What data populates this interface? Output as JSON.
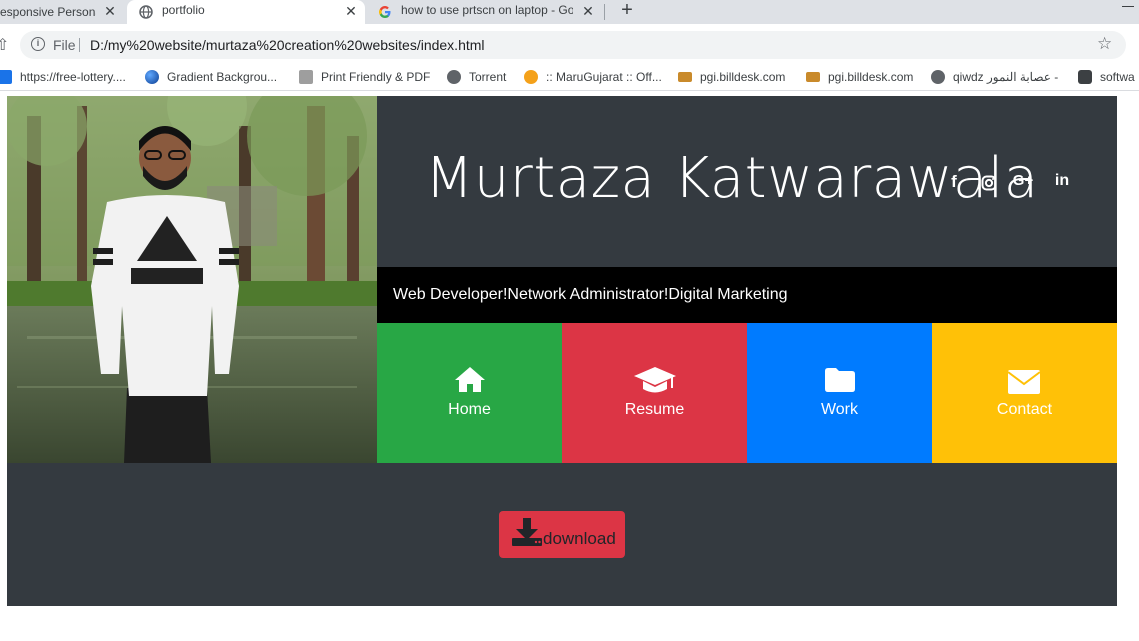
{
  "browser": {
    "tabs": [
      {
        "title": "esponsive Persona",
        "active": false
      },
      {
        "title": "portfolio",
        "active": true
      },
      {
        "title": "how to use prtscn on laptop - Go",
        "active": false
      }
    ],
    "close_glyph": "✕",
    "new_tab_glyph": "+",
    "url_scheme": "File",
    "url": "D:/my%20website/murtaza%20creation%20websites/index.html",
    "bookmarks": [
      {
        "label": "https://free-lottery....",
        "icon": "lottery-icon"
      },
      {
        "label": "Gradient Backgrou...",
        "icon": "gradient-globe-icon"
      },
      {
        "label": "Print Friendly & PDF",
        "icon": "printer-icon"
      },
      {
        "label": "Torrent",
        "icon": "globe-icon"
      },
      {
        "label": ":: MaruGujarat :: Off...",
        "icon": "marugujarat-icon"
      },
      {
        "label": "pgi.billdesk.com",
        "icon": "billdesk-icon"
      },
      {
        "label": "pgi.billdesk.com",
        "icon": "billdesk-icon"
      },
      {
        "label": "qiwdz عصابة النمور -",
        "icon": "globe-icon"
      },
      {
        "label": "softwa",
        "icon": "software-icon"
      }
    ]
  },
  "hero": {
    "name": "Murtaza Katwarawala",
    "tagline": "Web Developer!Network Administrator!Digital Marketing",
    "social": [
      "f",
      "G+",
      "in"
    ]
  },
  "nav": [
    {
      "label": "Home",
      "icon": "home-icon",
      "color": "#28a745"
    },
    {
      "label": "Resume",
      "icon": "graduation-cap-icon",
      "color": "#dc3545"
    },
    {
      "label": "Work",
      "icon": "folder-icon",
      "color": "#007bff"
    },
    {
      "label": "Contact",
      "icon": "envelope-icon",
      "color": "#ffc107"
    }
  ],
  "download": {
    "label": "download",
    "color": "#dc3545"
  },
  "colors": {
    "page_bg": "#343a40",
    "tagline_bg": "#000000"
  }
}
